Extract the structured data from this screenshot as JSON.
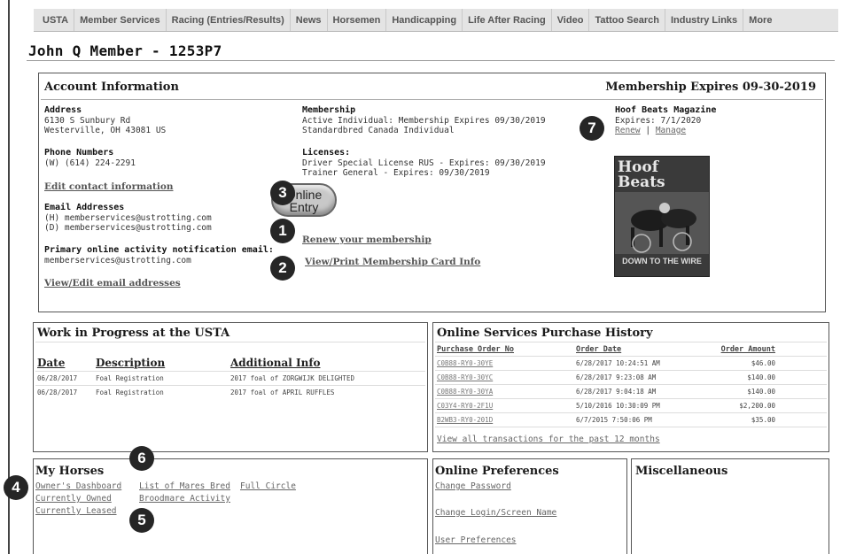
{
  "nav": [
    "USTA",
    "Member Services",
    "Racing (Entries/Results)",
    "News",
    "Horsemen",
    "Handicapping",
    "Life After Racing",
    "Video",
    "Tattoo Search",
    "Industry Links",
    "More"
  ],
  "member_title": "John Q Member - 1253P7",
  "account": {
    "heading": "Account Information",
    "expires": "Membership Expires 09-30-2019",
    "address_label": "Address",
    "address_line1": "6130 S Sunbury Rd",
    "address_line2": "Westerville, OH 43081 US",
    "phone_label": "Phone Numbers",
    "phone": "(W) (614) 224-2291",
    "edit_contact": "Edit contact information",
    "email_label": "Email Addresses",
    "email_h": "(H) memberservices@ustrotting.com",
    "email_d": "(D) memberservices@ustrotting.com",
    "primary_label": "Primary online activity notification email:",
    "primary_email": "memberservices@ustrotting.com",
    "view_edit_email": "View/Edit email addresses",
    "membership_label": "Membership",
    "membership_line1": "Active Individual: Membership Expires 09/30/2019",
    "membership_line2": "Standardbred Canada Individual",
    "licenses_label": "Licenses:",
    "license1": "Driver Special License RUS - Expires: 09/30/2019",
    "license2": "Trainer General - Expires: 09/30/2019",
    "online_entry_1": "Online",
    "online_entry_2": "Entry",
    "renew_membership": "Renew your membership",
    "print_card": "View/Print Membership Card Info",
    "magazine_label": "Hoof Beats Magazine",
    "magazine_expires": "Expires: 7/1/2020",
    "renew": "Renew",
    "separator": "|",
    "manage": "Manage",
    "cover_title": "Hoof Beats",
    "cover_tagline": "DOWN TO THE WIRE"
  },
  "badges": [
    "1",
    "2",
    "3",
    "4",
    "5",
    "6",
    "7"
  ],
  "wip": {
    "heading": "Work in Progress at the USTA",
    "headers": [
      "Date",
      "Description",
      "Additional Info"
    ],
    "rows": [
      [
        "06/28/2017",
        "Foal Registration",
        "2017 foal of ZORGWIJK DELIGHTED"
      ],
      [
        "06/28/2017",
        "Foal Registration",
        "2017 foal of APRIL RUFFLES"
      ]
    ]
  },
  "history": {
    "heading": "Online Services Purchase History",
    "headers": [
      "Purchase Order No",
      "Order Date",
      "Order Amount"
    ],
    "rows": [
      [
        "C0B88-RY0-30YE",
        "6/28/2017 10:24:51 AM",
        "$46.00"
      ],
      [
        "C0B88-RY0-30YC",
        "6/28/2017 9:23:08 AM",
        "$140.00"
      ],
      [
        "C0B88-RY0-30YA",
        "6/28/2017 9:04:18 AM",
        "$140.00"
      ],
      [
        "C03Y4-RY0-2F1U",
        "5/10/2016 10:30:09 PM",
        "$2,200.00"
      ],
      [
        "B2WB3-RY0-201D",
        "6/7/2015 7:50:06 PM",
        "$35.00"
      ]
    ],
    "view_all": "View all transactions for the past 12 months"
  },
  "horses": {
    "heading": "My Horses",
    "links": [
      "Owner's Dashboard",
      "List of Mares Bred",
      "Full Circle",
      "Currently Owned",
      "Broodmare Activity",
      "Currently Leased"
    ]
  },
  "prefs": {
    "heading": "Online Preferences",
    "links": [
      "Change Password",
      "Change Login/Screen Name",
      "User Preferences"
    ]
  },
  "misc": {
    "heading": "Miscellaneous"
  }
}
